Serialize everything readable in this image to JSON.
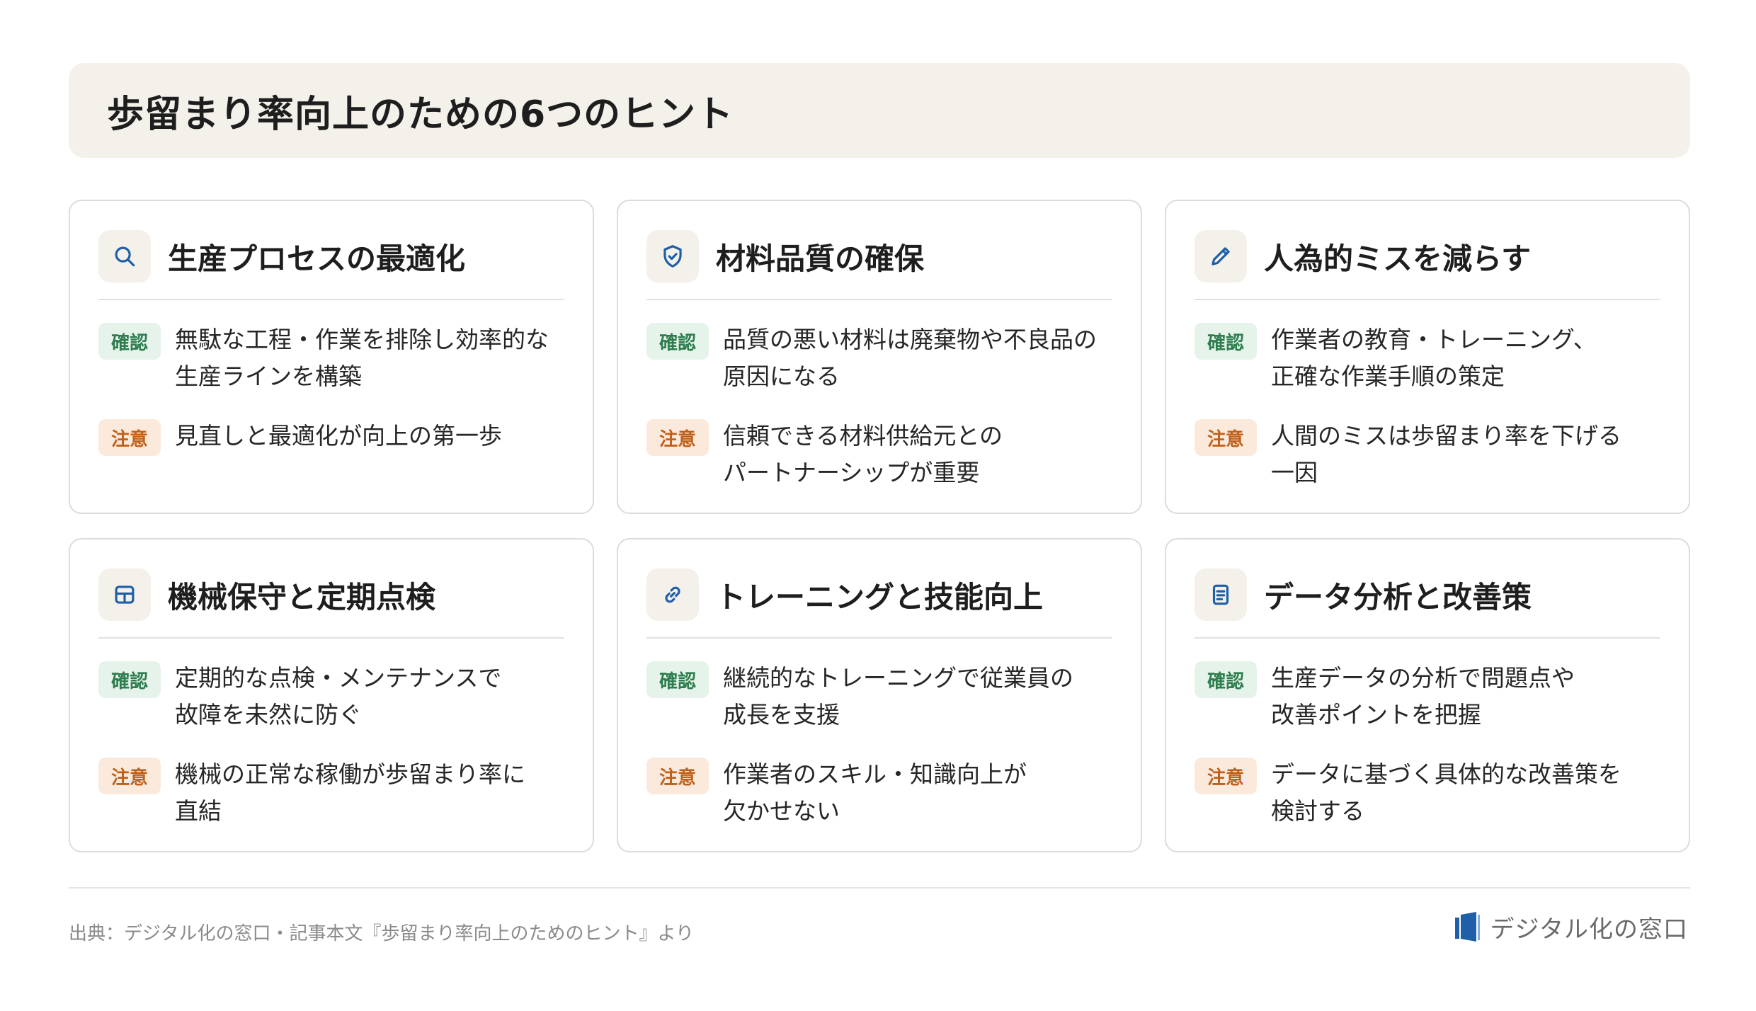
{
  "page": {
    "title": "歩留まり率向上のための6つのヒント",
    "source": "出典：デジタル化の窓口・記事本文『歩留まり率向上のためのヒント』より",
    "brand": "デジタル化の窓口"
  },
  "labels": {
    "confirm": "確認",
    "note": "注意"
  },
  "colors": {
    "accent": "#1f5fa8",
    "confirm_bg": "#e6f3ea",
    "confirm_text": "#2e7d4f",
    "note_bg": "#fbeadc",
    "note_text": "#c0601a",
    "banner_bg": "#f4f1eb"
  },
  "cards": [
    {
      "icon": "search-icon",
      "title": "生産プロセスの最適化",
      "confirm": "無駄な工程・作業を排除し効率的な\n生産ラインを構築",
      "note": "見直しと最適化が向上の第一歩"
    },
    {
      "icon": "shield-check-icon",
      "title": "材料品質の確保",
      "confirm": "品質の悪い材料は廃棄物や不良品の\n原因になる",
      "note": "信頼できる材料供給元との\nパートナーシップが重要"
    },
    {
      "icon": "pencil-icon",
      "title": "人為的ミスを減らす",
      "confirm": "作業者の教育・トレーニング、\n正確な作業手順の策定",
      "note": "人間のミスは歩留まり率を下げる\n一因"
    },
    {
      "icon": "grid-icon",
      "title": "機械保守と定期点検",
      "confirm": "定期的な点検・メンテナンスで\n故障を未然に防ぐ",
      "note": "機械の正常な稼働が歩留まり率に\n直結"
    },
    {
      "icon": "link-icon",
      "title": "トレーニングと技能向上",
      "confirm": "継続的なトレーニングで従業員の\n成長を支援",
      "note": "作業者のスキル・知識向上が\n欠かせない"
    },
    {
      "icon": "document-icon",
      "title": "データ分析と改善策",
      "confirm": "生産データの分析で問題点や\n改善ポイントを把握",
      "note": "データに基づく具体的な改善策を\n検討する"
    }
  ]
}
